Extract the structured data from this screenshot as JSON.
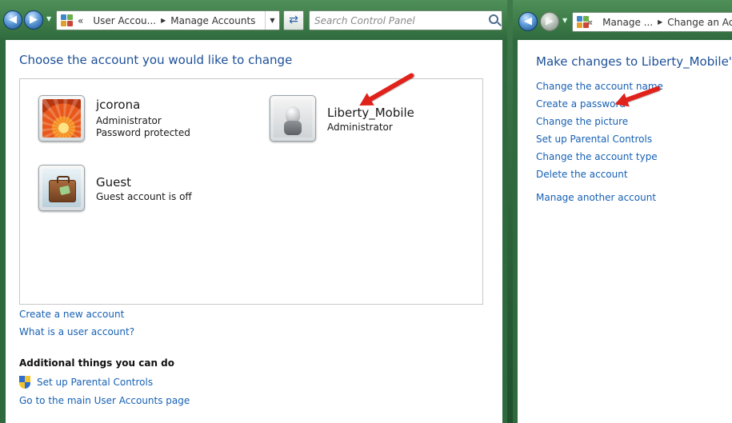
{
  "left_window": {
    "address": {
      "overflow": "«",
      "crumbs": [
        "User Accou...",
        "Manage Accounts"
      ]
    },
    "search": {
      "placeholder": "Search Control Panel"
    },
    "heading": "Choose the account you would like to change",
    "accounts": [
      {
        "name": "jcorona",
        "line1": "Administrator",
        "line2": "Password protected",
        "picture": "orange-flower-picture"
      },
      {
        "name": "Liberty_Mobile",
        "line1": "Administrator",
        "line2": "",
        "picture": "robot-picture"
      },
      {
        "name": "Guest",
        "line1": "Guest account is off",
        "line2": "",
        "picture": "suitcase-picture"
      }
    ],
    "links": {
      "create_account": "Create a new account",
      "what_is": "What is a user account?"
    },
    "additional": {
      "title": "Additional things you can do",
      "parental": "Set up Parental Controls",
      "main_page": "Go to the main User Accounts page"
    }
  },
  "right_window": {
    "address": {
      "overflow": "«",
      "crumbs": [
        "Manage ...",
        "Change an Acc"
      ]
    },
    "heading": "Make changes to Liberty_Mobile's a",
    "tasks": [
      "Change the account name",
      "Create a password",
      "Change the picture",
      "Set up Parental Controls",
      "Change the account type",
      "Delete the account"
    ],
    "manage_another": "Manage another account"
  },
  "colors": {
    "link": "#1660b4",
    "heading": "#1c4f98",
    "annotation_arrow": "#e0221b",
    "frame": "#3c7a46"
  }
}
